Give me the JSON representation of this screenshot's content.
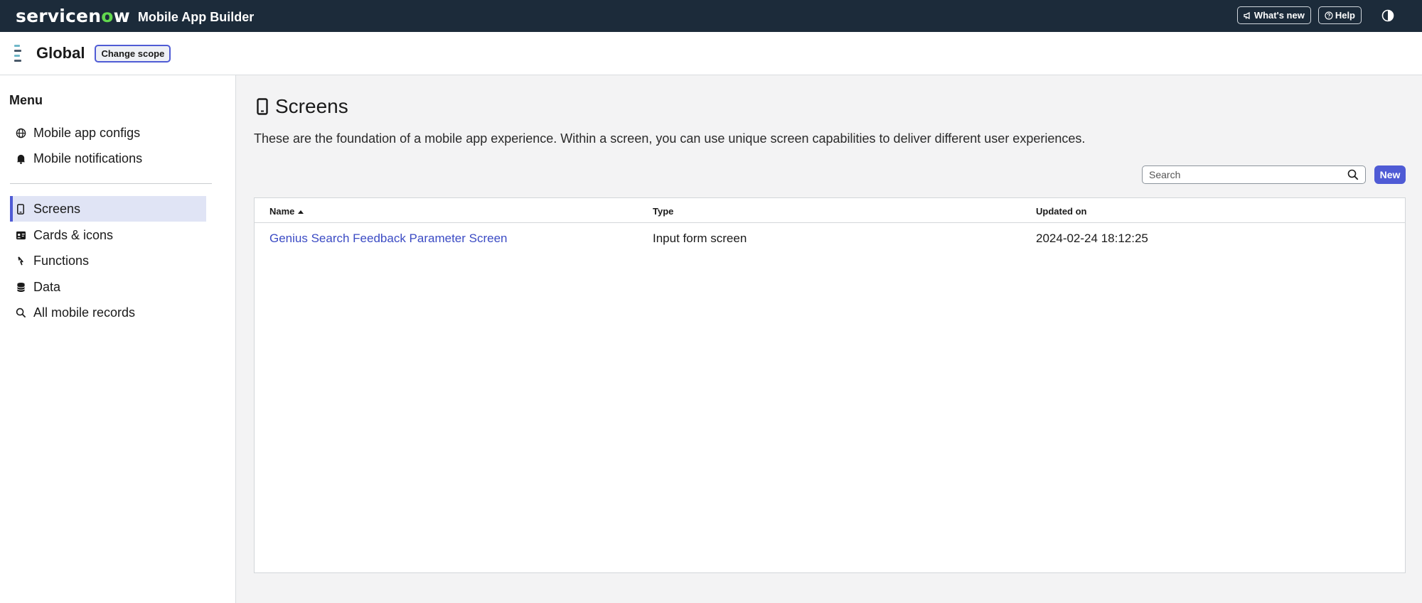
{
  "topbar": {
    "logo_pre": "servicen",
    "logo_o": "o",
    "logo_post": "w",
    "app_title": "Mobile App Builder",
    "whats_new_label": "What's new",
    "help_label": "Help"
  },
  "scope": {
    "name": "Global",
    "change_label": "Change scope"
  },
  "sidebar": {
    "title": "Menu",
    "items": [
      {
        "label": "Mobile app configs",
        "icon": "globe-icon"
      },
      {
        "label": "Mobile notifications",
        "icon": "bell-icon"
      },
      {
        "label": "Screens",
        "icon": "mobile-icon",
        "active": true
      },
      {
        "label": "Cards & icons",
        "icon": "card-icon"
      },
      {
        "label": "Functions",
        "icon": "function-icon"
      },
      {
        "label": "Data",
        "icon": "database-icon"
      },
      {
        "label": "All mobile records",
        "icon": "search-icon"
      }
    ]
  },
  "main": {
    "title": "Screens",
    "description": "These are the foundation of a mobile app experience. Within a screen, you can use unique screen capabilities to deliver different user experiences.",
    "search_placeholder": "Search",
    "new_label": "New",
    "table": {
      "columns": [
        "Name",
        "Type",
        "Updated on"
      ],
      "sort_column": "Name",
      "sort_direction": "ascending",
      "rows": [
        {
          "name": "Genius Search Feedback Parameter Screen",
          "type": "Input form screen",
          "updated_on": "2024-02-24 18:12:25"
        }
      ]
    }
  },
  "colors": {
    "topbar_bg": "#1c2b3a",
    "accent": "#4f5bd5",
    "active_nav_bg": "#e0e4f5",
    "link": "#3b4bc4"
  }
}
